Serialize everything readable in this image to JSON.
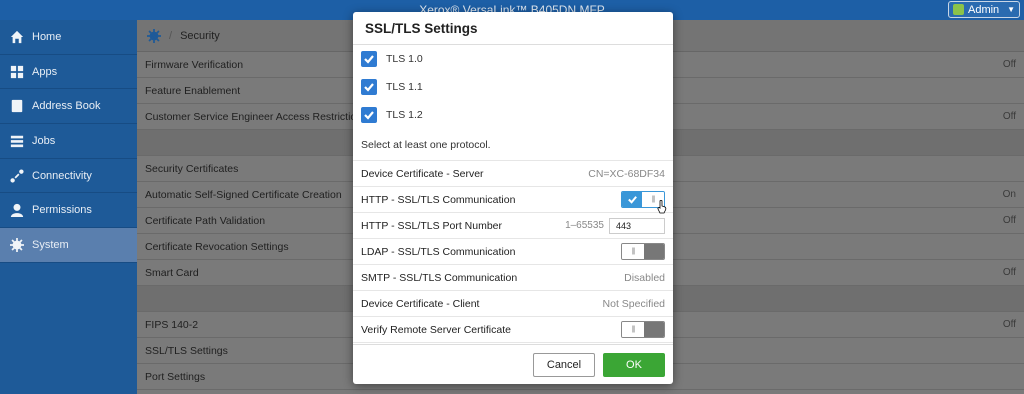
{
  "window": {
    "title": "Xerox® VersaLink™ B405DN MFP",
    "user_label": "Admin"
  },
  "sidebar": {
    "items": [
      {
        "label": "Home",
        "icon": "home-icon",
        "active": false
      },
      {
        "label": "Apps",
        "icon": "apps-icon",
        "active": false
      },
      {
        "label": "Address Book",
        "icon": "address-book-icon",
        "active": false
      },
      {
        "label": "Jobs",
        "icon": "jobs-icon",
        "active": false
      },
      {
        "label": "Connectivity",
        "icon": "connectivity-icon",
        "active": false
      },
      {
        "label": "Permissions",
        "icon": "permissions-icon",
        "active": false
      },
      {
        "label": "System",
        "icon": "gear-icon",
        "active": true
      }
    ]
  },
  "breadcrumb": {
    "current": "Security"
  },
  "security_list": [
    {
      "label": "Firmware Verification",
      "value": "Off"
    },
    {
      "label": "Feature Enablement",
      "value": ""
    },
    {
      "label": "Customer Service Engineer Access Restriction",
      "value": "Off"
    },
    {
      "label": "",
      "value": ""
    },
    {
      "label": "Security Certificates",
      "value": ""
    },
    {
      "label": "Automatic Self-Signed Certificate Creation",
      "value": "On"
    },
    {
      "label": "Certificate Path Validation",
      "value": "Off"
    },
    {
      "label": "Certificate Revocation Settings",
      "value": ""
    },
    {
      "label": "Smart Card",
      "value": "Off"
    },
    {
      "label": "",
      "value": ""
    },
    {
      "label": "FIPS 140-2",
      "value": "Off"
    },
    {
      "label": "SSL/TLS Settings",
      "value": ""
    },
    {
      "label": "Port Settings",
      "value": ""
    }
  ],
  "dialog": {
    "title": "SSL/TLS Settings",
    "protocols": [
      {
        "label": "TLS 1.0",
        "checked": true
      },
      {
        "label": "TLS 1.1",
        "checked": true
      },
      {
        "label": "TLS 1.2",
        "checked": true
      }
    ],
    "hint": "Select at least one protocol.",
    "server_cert": {
      "label": "Device Certificate - Server",
      "value": "CN=XC-68DF34"
    },
    "http_comm": {
      "label": "HTTP - SSL/TLS Communication",
      "on": true
    },
    "http_port": {
      "label": "HTTP - SSL/TLS Port Number",
      "range": "1–65535",
      "value": "443"
    },
    "ldap_comm": {
      "label": "LDAP - SSL/TLS Communication",
      "on": false
    },
    "smtp_comm": {
      "label": "SMTP - SSL/TLS Communication",
      "value": "Disabled"
    },
    "client_cert": {
      "label": "Device Certificate - Client",
      "value": "Not Specified"
    },
    "verify_remote": {
      "label": "Verify Remote Server Certificate",
      "on": false
    },
    "cancel_label": "Cancel",
    "ok_label": "OK"
  },
  "colors": {
    "accent": "#2f7bd2",
    "ok": "#3ba635",
    "sidebar": "#1e5a98"
  }
}
